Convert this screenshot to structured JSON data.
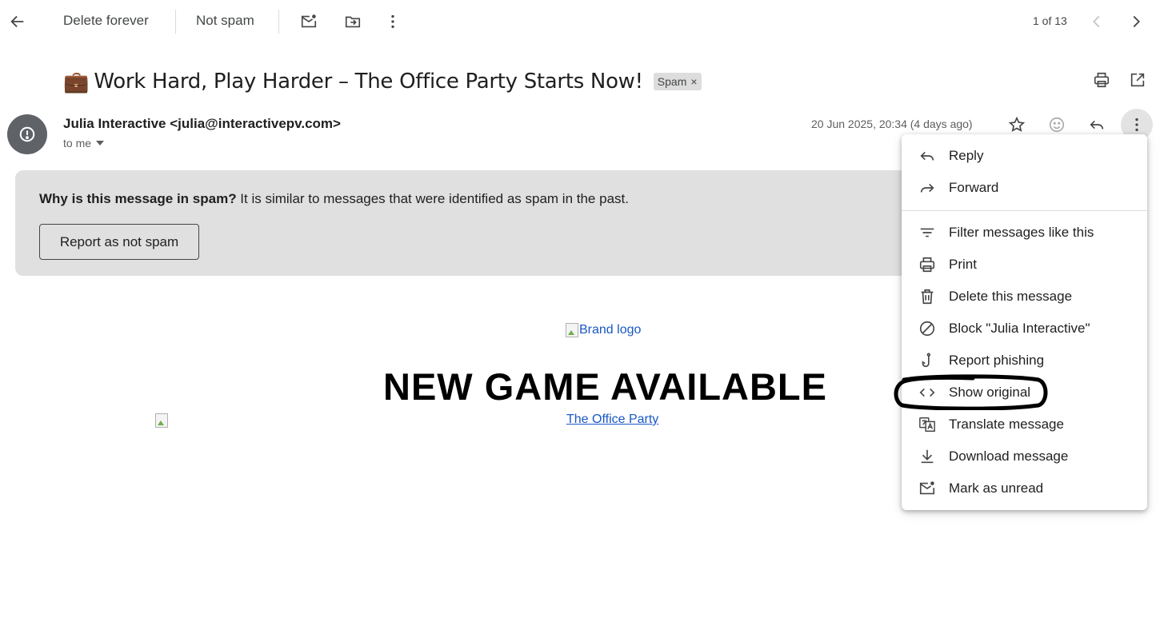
{
  "toolbar": {
    "back_icon": "arrow-back-icon",
    "delete_forever_label": "Delete forever",
    "not_spam_label": "Not spam",
    "mark_unread_icon": "mark-unread-icon",
    "move_to_icon": "move-to-folder-icon",
    "more_icon": "more-vert-icon",
    "pager_text": "1 of 13",
    "prev_icon": "chevron-left-icon",
    "next_icon": "chevron-right-icon"
  },
  "subject": {
    "emoji": "💼",
    "text": "Work Hard, Play Harder – The Office Party Starts Now!",
    "label_chip": "Spam",
    "chip_remove": "×",
    "print_icon": "print-icon",
    "new_window_icon": "open-in-new-icon"
  },
  "sender": {
    "avatar_icon": "warning-circle-icon",
    "name_email": "Julia Interactive <julia@interactivepv.com>",
    "to_text": "to me",
    "date_text": "20 Jun 2025, 20:34 (4 days ago)",
    "star_icon": "star-icon",
    "emoji_icon": "emoji-reaction-icon",
    "reply_icon": "reply-icon",
    "more_icon": "more-vert-icon"
  },
  "spam_notice": {
    "question": "Why is this message in spam?",
    "explanation": " It is similar to messages that were identified as spam in the past.",
    "report_button": "Report as not spam"
  },
  "message_body": {
    "brand_logo_alt": "Brand logo",
    "headline": "NEW GAME AVAILABLE",
    "link_text": "The Office Party"
  },
  "menu": {
    "items": [
      {
        "label": "Reply",
        "icon": "reply-icon"
      },
      {
        "label": "Forward",
        "icon": "forward-icon"
      },
      {
        "label": "Filter messages like this",
        "icon": "filter-icon"
      },
      {
        "label": "Print",
        "icon": "print-icon"
      },
      {
        "label": "Delete this message",
        "icon": "trash-icon"
      },
      {
        "label": "Block \"Julia Interactive\"",
        "icon": "block-icon"
      },
      {
        "label": "Report phishing",
        "icon": "phishing-hook-icon"
      },
      {
        "label": "Show original",
        "icon": "code-icon"
      },
      {
        "label": "Translate message",
        "icon": "translate-icon"
      },
      {
        "label": "Download message",
        "icon": "download-icon"
      },
      {
        "label": "Mark as unread",
        "icon": "mark-unread-icon"
      }
    ]
  },
  "colors": {
    "link": "#1a57c6",
    "spam_box_bg": "#e0e0e0",
    "avatar_bg": "#5f6368",
    "annotation": "#000000"
  }
}
